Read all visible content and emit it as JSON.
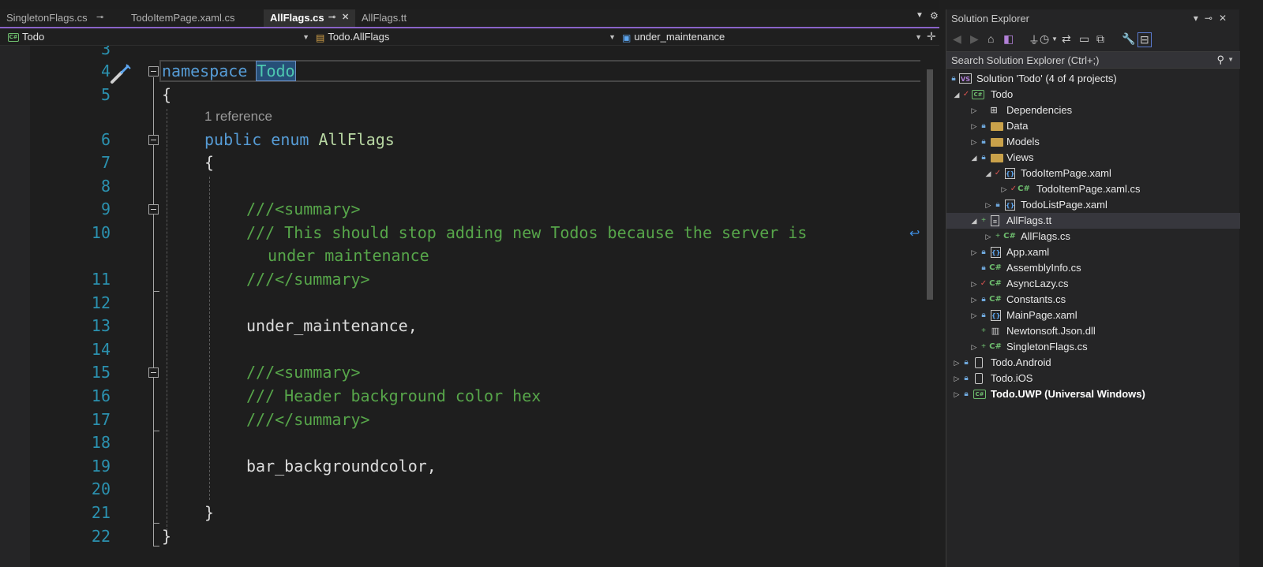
{
  "editor": {
    "tabs": [
      {
        "label": "SingletonFlags.cs",
        "pinned": true,
        "active": false
      },
      {
        "label": "TodoItemPage.xaml.cs",
        "pinned": false,
        "active": false
      },
      {
        "label": "AllFlags.cs",
        "pinned": true,
        "active": true
      },
      {
        "label": "AllFlags.tt",
        "pinned": false,
        "active": false
      }
    ],
    "nav": {
      "project": "Todo",
      "type": "Todo.AllFlags",
      "member": "under_maintenance"
    },
    "codelens": "1 reference",
    "line_numbers": [
      "3",
      "4",
      "5",
      "6",
      "7",
      "8",
      "9",
      "10",
      "11",
      "12",
      "13",
      "14",
      "15",
      "16",
      "17",
      "18",
      "19",
      "20",
      "21",
      "22"
    ],
    "code": {
      "l4_kw": "namespace",
      "l4_name": "Todo",
      "l5": "{",
      "l6_kw1": "public",
      "l6_kw2": "enum",
      "l6_name": "AllFlags",
      "l7": "{",
      "l9": "///<summary>",
      "l10a": "/// This should stop adding new Todos because the server is",
      "l10b": "under maintenance",
      "l11": "///</summary>",
      "l13": "under_maintenance,",
      "l15": "///<summary>",
      "l16": "/// Header background color hex",
      "l17": "///</summary>",
      "l19": "bar_backgroundcolor,",
      "l21": "}",
      "l22": "}"
    }
  },
  "solution_explorer": {
    "title": "Solution Explorer",
    "search_placeholder": "Search Solution Explorer (Ctrl+;)",
    "tree": [
      {
        "label": "Solution 'Todo' (4 of 4 projects)"
      },
      {
        "label": "Todo"
      },
      {
        "label": "Dependencies"
      },
      {
        "label": "Data"
      },
      {
        "label": "Models"
      },
      {
        "label": "Views"
      },
      {
        "label": "TodoItemPage.xaml"
      },
      {
        "label": "TodoItemPage.xaml.cs"
      },
      {
        "label": "TodoListPage.xaml"
      },
      {
        "label": "AllFlags.tt"
      },
      {
        "label": "AllFlags.cs"
      },
      {
        "label": "App.xaml"
      },
      {
        "label": "AssemblyInfo.cs"
      },
      {
        "label": "AsyncLazy.cs"
      },
      {
        "label": "Constants.cs"
      },
      {
        "label": "MainPage.xaml"
      },
      {
        "label": "Newtonsoft.Json.dll"
      },
      {
        "label": "SingletonFlags.cs"
      },
      {
        "label": "Todo.Android"
      },
      {
        "label": "Todo.iOS"
      },
      {
        "label": "Todo.UWP (Universal Windows)"
      }
    ]
  },
  "colors": {
    "keyword": "#569cd6",
    "type": "#b8d7a3",
    "comment": "#57a64a",
    "line_number": "#2b91af",
    "tab_accent": "#8a63c8"
  }
}
